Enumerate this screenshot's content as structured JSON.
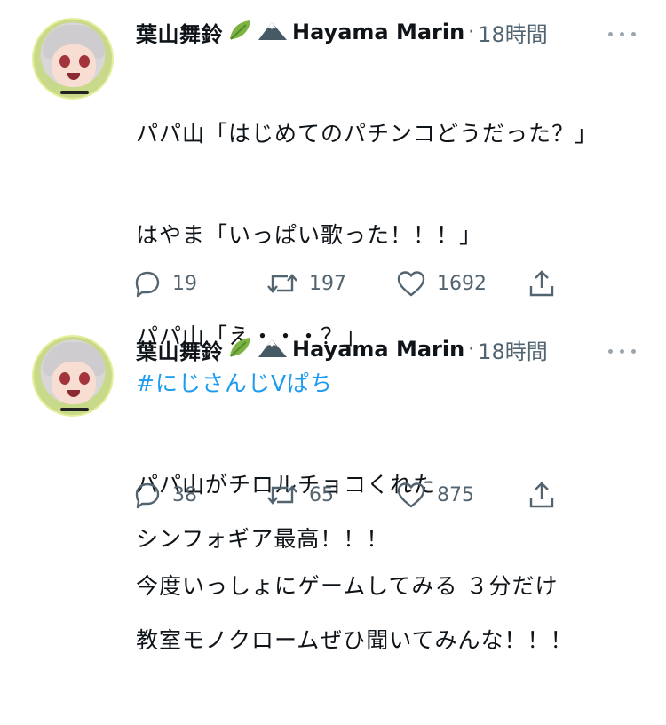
{
  "tweets": [
    {
      "display_name": "葉山舞鈴",
      "emoji_badges": [
        "leaf-icon",
        "mountain-icon"
      ],
      "account_name": "Hayama Marin",
      "separator": "·",
      "time": "18時間",
      "hashtag": "",
      "lines": [
        "パパ山「はじめてのパチンコどうだった？」",
        "はやま「いっぱい歌った！！！」",
        "パパ山「え・・・？」",
        "",
        "シンフォギア最高！！！",
        "教室モノクロームぜひ聞いてみんな！！！"
      ],
      "replies": "19",
      "retweets": "197",
      "likes": "1692"
    },
    {
      "display_name": "葉山舞鈴",
      "emoji_badges": [
        "leaf-icon",
        "mountain-icon"
      ],
      "account_name": "Hayama Marin",
      "separator": "·",
      "time": "18時間",
      "hashtag": "#にじさんじVぱち",
      "lines": [
        "パパ山がチロルチョコくれた",
        "今度いっしょにゲームしてみる ３分だけ"
      ],
      "replies": "38",
      "retweets": "65",
      "likes": "875"
    }
  ],
  "colors": {
    "text": "#0f1419",
    "secondary": "#536471",
    "link": "#1d9bf0",
    "divider": "#e6e6e6"
  }
}
